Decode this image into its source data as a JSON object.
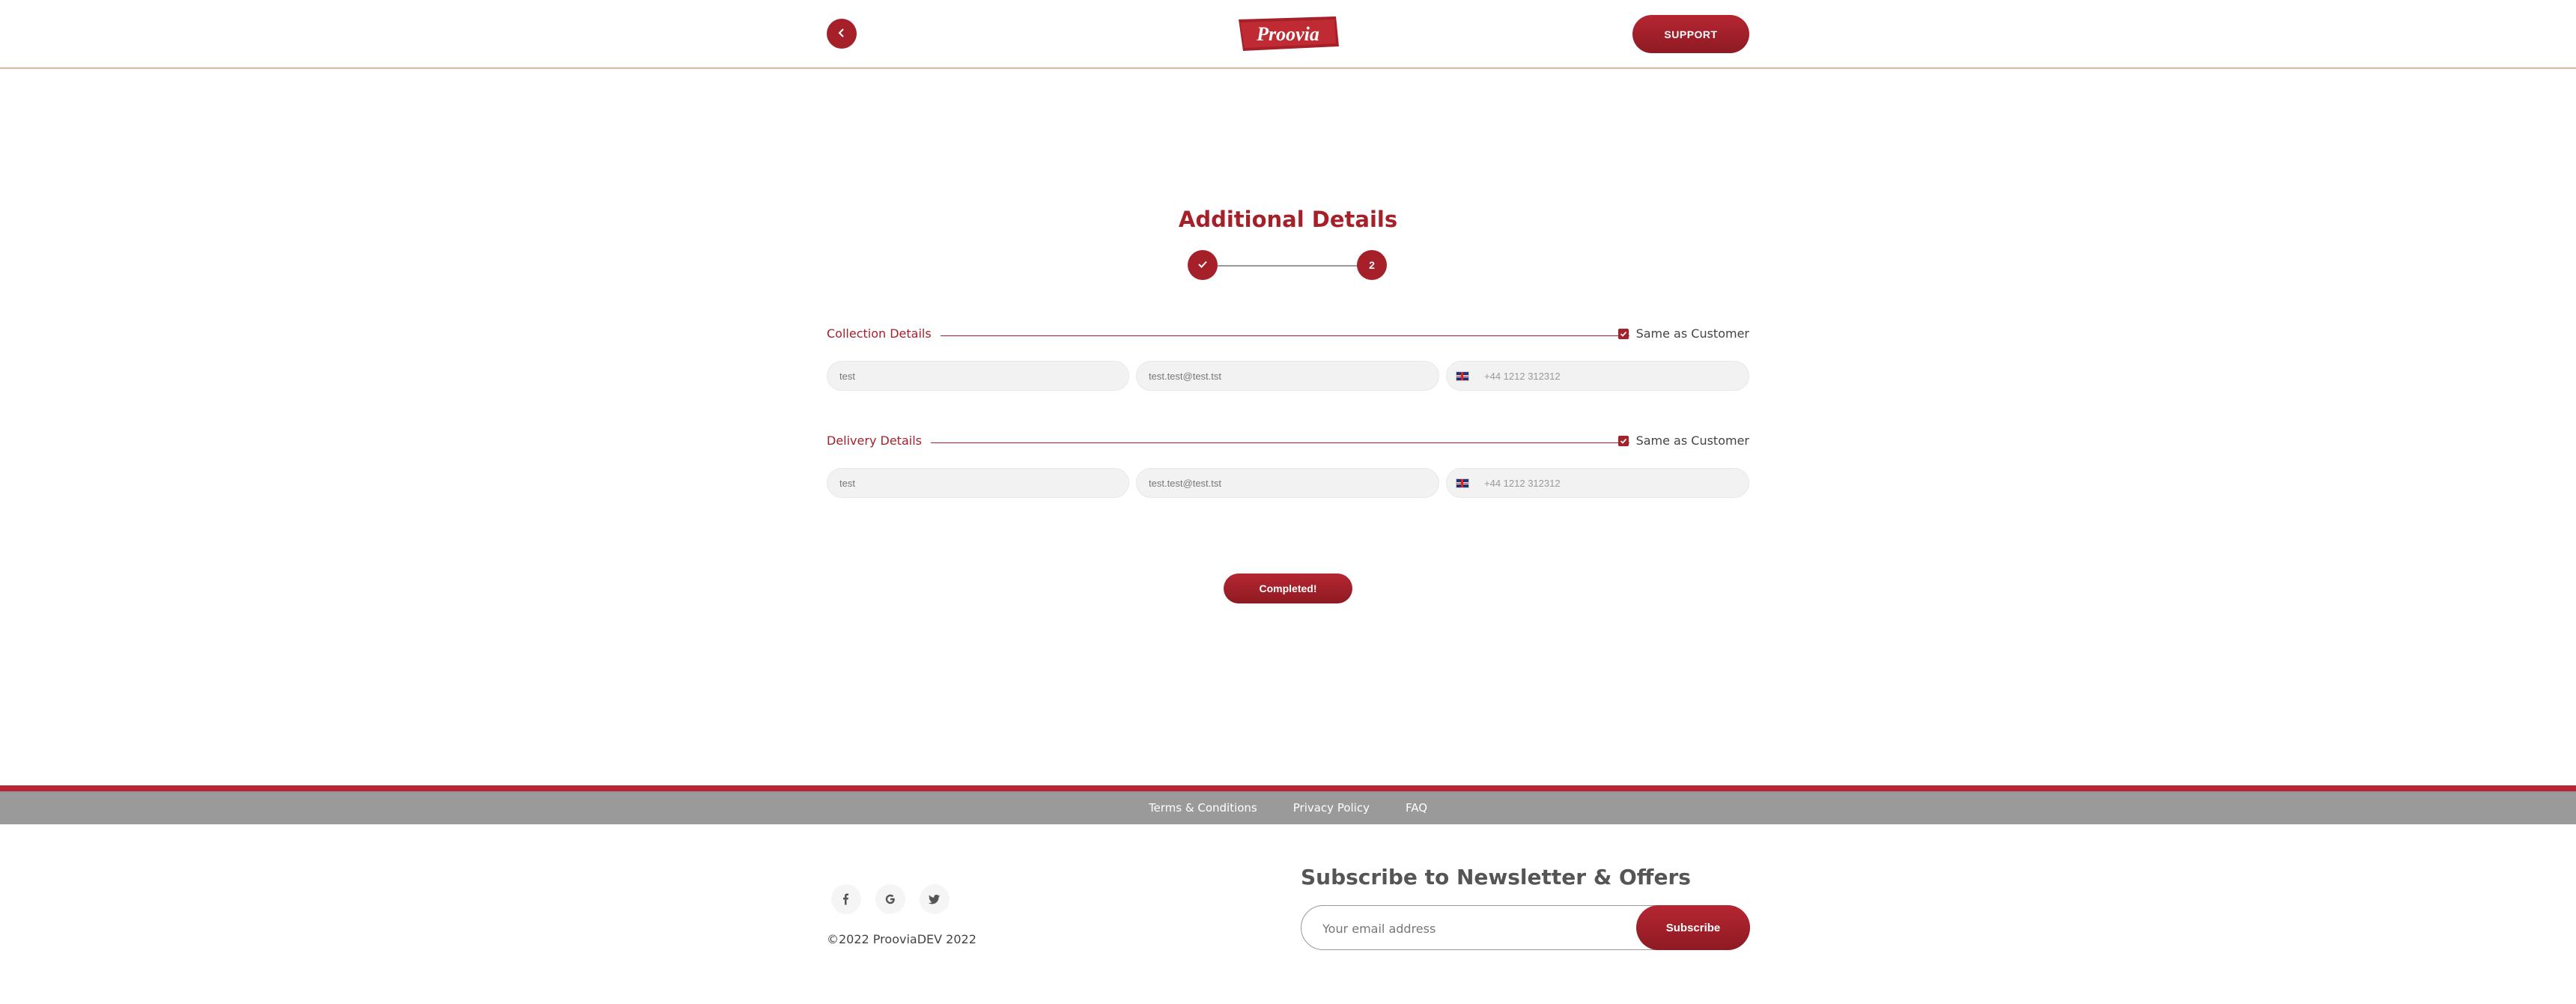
{
  "header": {
    "back_icon": "chevron-left-icon",
    "logo_text": "Proovia",
    "support_label": "SUPPORT"
  },
  "page": {
    "title": "Additional Details",
    "steps": [
      {
        "label": "",
        "icon": "check-icon",
        "state": "completed"
      },
      {
        "label": "2",
        "state": "current"
      }
    ]
  },
  "collection": {
    "title": "Collection Details",
    "same_label": "Same as Customer",
    "same_checked": true,
    "name": "test",
    "email": "test.test@test.tst",
    "phone": "+44 1212 312312"
  },
  "delivery": {
    "title": "Delivery Details",
    "same_label": "Same as Customer",
    "same_checked": true,
    "name": "test",
    "email": "test.test@test.tst",
    "phone": "+44 1212 312312"
  },
  "actions": {
    "complete_label": "Completed!"
  },
  "footer": {
    "links": [
      "Terms & Conditions",
      "Privacy Policy",
      "FAQ"
    ],
    "social": [
      "facebook-icon",
      "google-icon",
      "twitter-icon"
    ],
    "copyright": "©2022 ProoviaDEV 2022",
    "newsletter_title": "Subscribe to Newsletter & Offers",
    "email_placeholder": "Your email address",
    "subscribe_label": "Subscribe"
  },
  "colors": {
    "brand_red": "#a6202a",
    "footer_gray": "#9a9a9a"
  }
}
